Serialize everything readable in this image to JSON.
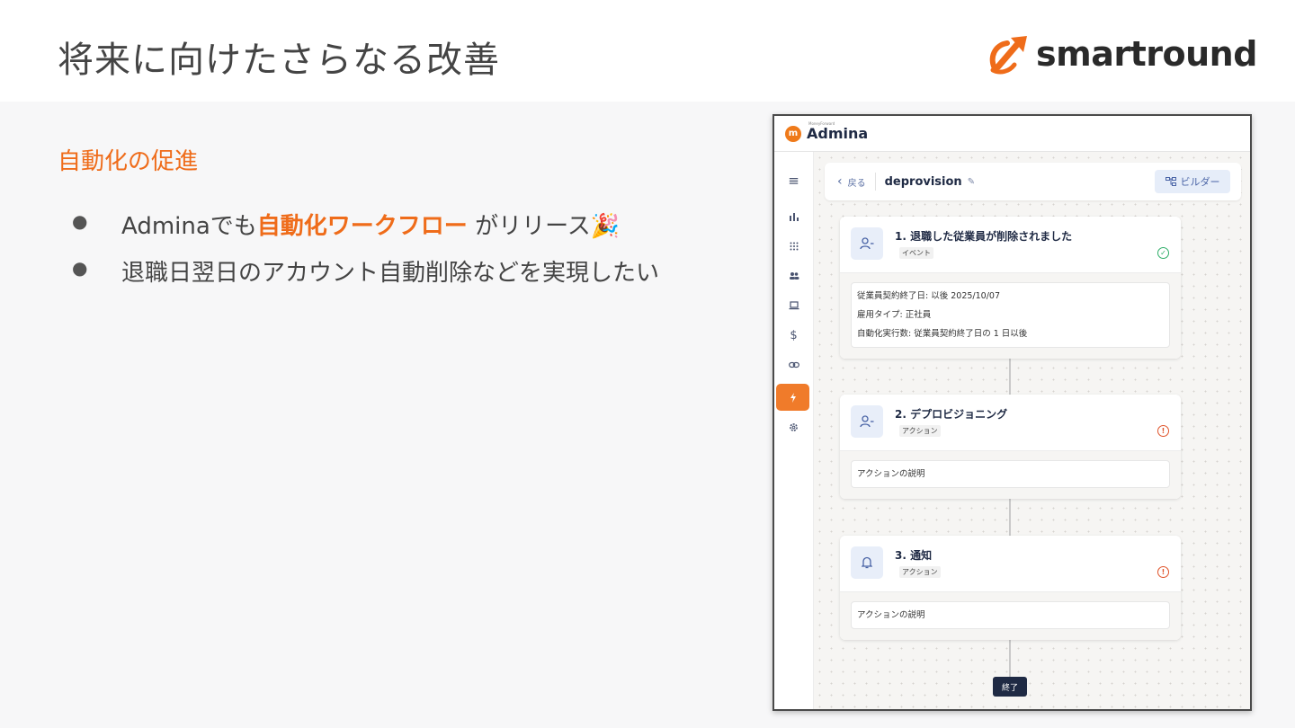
{
  "slide": {
    "title": "将来に向けたさらなる改善",
    "brand": "smartround",
    "subheading": "自動化の促進",
    "bullets": [
      {
        "pre": "Adminaでも",
        "highlight": "自動化ワークフロー",
        "post": " がリリース🎉"
      },
      {
        "text": "退職日翌日のアカウント自動削除などを実現したい"
      }
    ]
  },
  "app": {
    "logo_small": "MoneyForward",
    "logo": "Admina",
    "sidebar_icons": [
      "menu-icon",
      "chart-icon",
      "grid-icon",
      "users-icon",
      "laptop-icon",
      "dollar-icon",
      "link-icon",
      "lightning-icon",
      "gear-icon"
    ],
    "active_item": "lightning-icon",
    "back_label": "戻る",
    "workflow_name": "deprovision",
    "builder_label": "ビルダー",
    "nodes": [
      {
        "title": "1. 退職した従業員が削除されました",
        "tag": "イベント",
        "status": "ok",
        "lines": [
          "従業員契約終了日: 以後 2025/10/07",
          "雇用タイプ: 正社員",
          "自動化実行数: 従業員契約終了日の 1 日以後"
        ]
      },
      {
        "title": "2. デプロビジョニング",
        "tag": "アクション",
        "status": "warn",
        "lines": [
          "アクションの説明"
        ]
      },
      {
        "title": "3. 通知",
        "tag": "アクション",
        "status": "warn",
        "lines": [
          "アクションの説明"
        ]
      }
    ],
    "end_label": "終了"
  }
}
